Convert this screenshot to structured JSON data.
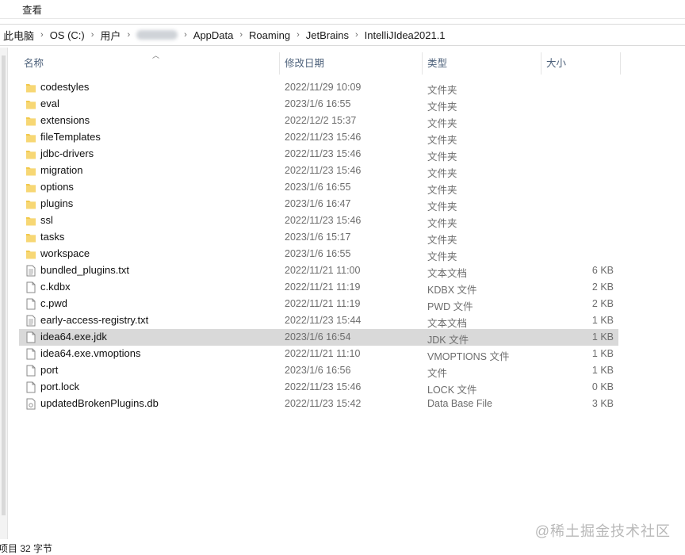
{
  "menu": {
    "view": "查看"
  },
  "breadcrumb": {
    "items": [
      "此电脑",
      "OS (C:)",
      "用户",
      "AppData",
      "Roaming",
      "JetBrains",
      "IntelliJIdea2021.1"
    ],
    "separator": "›"
  },
  "columns": {
    "name": "名称",
    "date": "修改日期",
    "type": "类型",
    "size": "大小"
  },
  "files": [
    {
      "name": "codestyles",
      "date": "2022/11/29 10:09",
      "type": "文件夹",
      "size": "",
      "kind": "folder-icon"
    },
    {
      "name": "eval",
      "date": "2023/1/6 16:55",
      "type": "文件夹",
      "size": "",
      "kind": "folder-icon"
    },
    {
      "name": "extensions",
      "date": "2022/12/2 15:37",
      "type": "文件夹",
      "size": "",
      "kind": "folder-icon"
    },
    {
      "name": "fileTemplates",
      "date": "2022/11/23 15:46",
      "type": "文件夹",
      "size": "",
      "kind": "folder-icon"
    },
    {
      "name": "jdbc-drivers",
      "date": "2022/11/23 15:46",
      "type": "文件夹",
      "size": "",
      "kind": "folder-icon"
    },
    {
      "name": "migration",
      "date": "2022/11/23 15:46",
      "type": "文件夹",
      "size": "",
      "kind": "folder-icon"
    },
    {
      "name": "options",
      "date": "2023/1/6 16:55",
      "type": "文件夹",
      "size": "",
      "kind": "folder-icon"
    },
    {
      "name": "plugins",
      "date": "2023/1/6 16:47",
      "type": "文件夹",
      "size": "",
      "kind": "folder-icon"
    },
    {
      "name": "ssl",
      "date": "2022/11/23 15:46",
      "type": "文件夹",
      "size": "",
      "kind": "folder-icon"
    },
    {
      "name": "tasks",
      "date": "2023/1/6 15:17",
      "type": "文件夹",
      "size": "",
      "kind": "folder-icon"
    },
    {
      "name": "workspace",
      "date": "2023/1/6 16:55",
      "type": "文件夹",
      "size": "",
      "kind": "folder-icon"
    },
    {
      "name": "bundled_plugins.txt",
      "date": "2022/11/21 11:00",
      "type": "文本文档",
      "size": "6 KB",
      "kind": "text-file-icon"
    },
    {
      "name": "c.kdbx",
      "date": "2022/11/21 11:19",
      "type": "KDBX 文件",
      "size": "2 KB",
      "kind": "file-icon"
    },
    {
      "name": "c.pwd",
      "date": "2022/11/21 11:19",
      "type": "PWD 文件",
      "size": "2 KB",
      "kind": "file-icon"
    },
    {
      "name": "early-access-registry.txt",
      "date": "2022/11/23 15:44",
      "type": "文本文档",
      "size": "1 KB",
      "kind": "text-file-icon"
    },
    {
      "name": "idea64.exe.jdk",
      "date": "2023/1/6 16:54",
      "type": "JDK 文件",
      "size": "1 KB",
      "kind": "file-icon",
      "selected": true
    },
    {
      "name": "idea64.exe.vmoptions",
      "date": "2022/11/21 11:10",
      "type": "VMOPTIONS 文件",
      "size": "1 KB",
      "kind": "file-icon"
    },
    {
      "name": "port",
      "date": "2023/1/6 16:56",
      "type": "文件",
      "size": "1 KB",
      "kind": "file-icon"
    },
    {
      "name": "port.lock",
      "date": "2022/11/23 15:46",
      "type": "LOCK 文件",
      "size": "0 KB",
      "kind": "file-icon"
    },
    {
      "name": "updatedBrokenPlugins.db",
      "date": "2022/11/23 15:42",
      "type": "Data Base File",
      "size": "3 KB",
      "kind": "db-file-icon"
    }
  ],
  "status": {
    "text": "项目 32 字节"
  },
  "watermark": "@稀土掘金技术社区",
  "colors": {
    "folder": "#f2c94c",
    "selected_row": "#d9d9d9",
    "header_text": "#4c607a"
  }
}
